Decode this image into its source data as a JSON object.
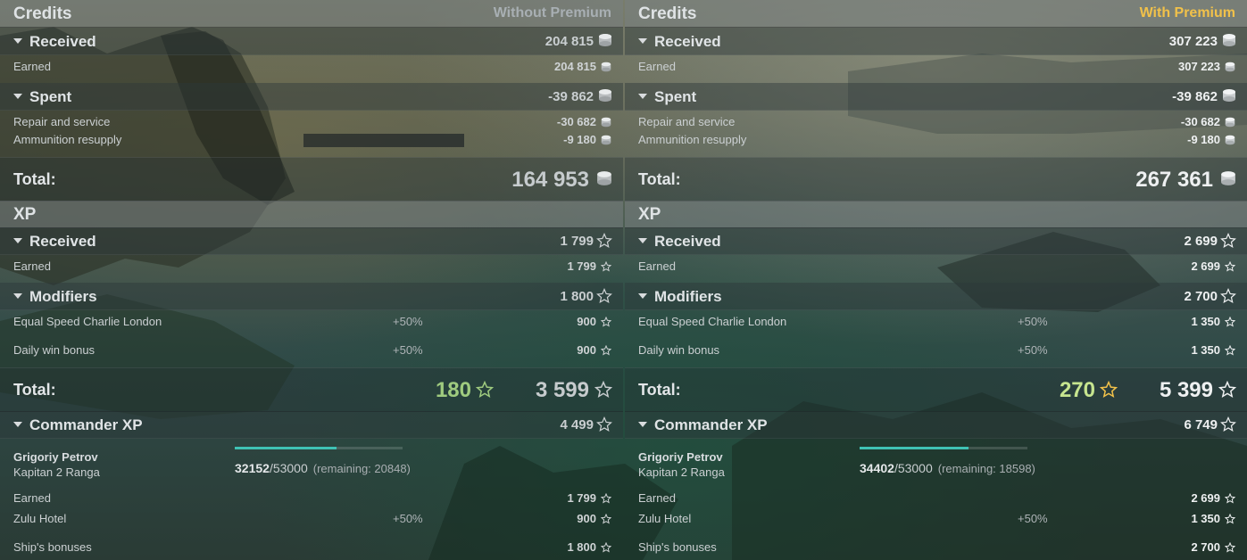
{
  "columns": [
    {
      "side": "left",
      "credits_header": {
        "title": "Credits",
        "mode": "Without Premium"
      },
      "credits_received": {
        "label": "Received",
        "value": "204 815"
      },
      "credits_earned": {
        "label": "Earned",
        "value": "204 815"
      },
      "credits_spent": {
        "label": "Spent",
        "value": "-39 862"
      },
      "repair": {
        "label": "Repair and service",
        "value": "-30 682"
      },
      "ammo": {
        "label": "Ammunition resupply",
        "value": "-9 180"
      },
      "credits_total": {
        "label": "Total:",
        "value": "164 953"
      },
      "xp_header": {
        "title": "XP"
      },
      "xp_received": {
        "label": "Received",
        "value": "1 799"
      },
      "xp_earned": {
        "label": "Earned",
        "value": "1 799"
      },
      "modifiers": {
        "label": "Modifiers",
        "value": "1 800"
      },
      "mod1": {
        "label": "Equal Speed Charlie London",
        "pct": "+50%",
        "value": "900"
      },
      "mod2": {
        "label": "Daily win bonus",
        "pct": "+50%",
        "value": "900"
      },
      "xp_total": {
        "label": "Total:",
        "free": "180",
        "value": "3 599"
      },
      "commander_xp": {
        "label": "Commander XP",
        "value": "4 499"
      },
      "commander": {
        "name": "Grigoriy Petrov",
        "rank": "Kapitan 2 Ranga",
        "current": "32152",
        "max": "/53000",
        "remaining": "(remaining: 20848)",
        "progress": 0.6066
      },
      "cmd_earned": {
        "label": "Earned",
        "value": "1 799"
      },
      "zulu": {
        "label": "Zulu Hotel",
        "pct": "+50%",
        "value": "900"
      },
      "ship_bonus": {
        "label": "Ship's bonuses",
        "value": "1 800"
      }
    },
    {
      "side": "right",
      "credits_header": {
        "title": "Credits",
        "mode": "With Premium"
      },
      "credits_received": {
        "label": "Received",
        "value": "307 223"
      },
      "credits_earned": {
        "label": "Earned",
        "value": "307 223"
      },
      "credits_spent": {
        "label": "Spent",
        "value": "-39 862"
      },
      "repair": {
        "label": "Repair and service",
        "value": "-30 682"
      },
      "ammo": {
        "label": "Ammunition resupply",
        "value": "-9 180"
      },
      "credits_total": {
        "label": "Total:",
        "value": "267 361"
      },
      "xp_header": {
        "title": "XP"
      },
      "xp_received": {
        "label": "Received",
        "value": "2 699"
      },
      "xp_earned": {
        "label": "Earned",
        "value": "2 699"
      },
      "modifiers": {
        "label": "Modifiers",
        "value": "2 700"
      },
      "mod1": {
        "label": "Equal Speed Charlie London",
        "pct": "+50%",
        "value": "1 350"
      },
      "mod2": {
        "label": "Daily win bonus",
        "pct": "+50%",
        "value": "1 350"
      },
      "xp_total": {
        "label": "Total:",
        "free": "270",
        "value": "5 399"
      },
      "commander_xp": {
        "label": "Commander XP",
        "value": "6 749"
      },
      "commander": {
        "name": "Grigoriy Petrov",
        "rank": "Kapitan 2 Ranga",
        "current": "34402",
        "max": "/53000",
        "remaining": "(remaining: 18598)",
        "progress": 0.6491
      },
      "cmd_earned": {
        "label": "Earned",
        "value": "2 699"
      },
      "zulu": {
        "label": "Zulu Hotel",
        "pct": "+50%",
        "value": "1 350"
      },
      "ship_bonus": {
        "label": "Ship's bonuses",
        "value": "2 700"
      }
    }
  ],
  "icons": {
    "credits": "credits-coin-icon",
    "xp": "xp-star-icon"
  },
  "colors": {
    "premium_accent": "#f1c14a",
    "free_xp_green": "#9fcb7f",
    "progress_fill": "#3fc2b4"
  }
}
